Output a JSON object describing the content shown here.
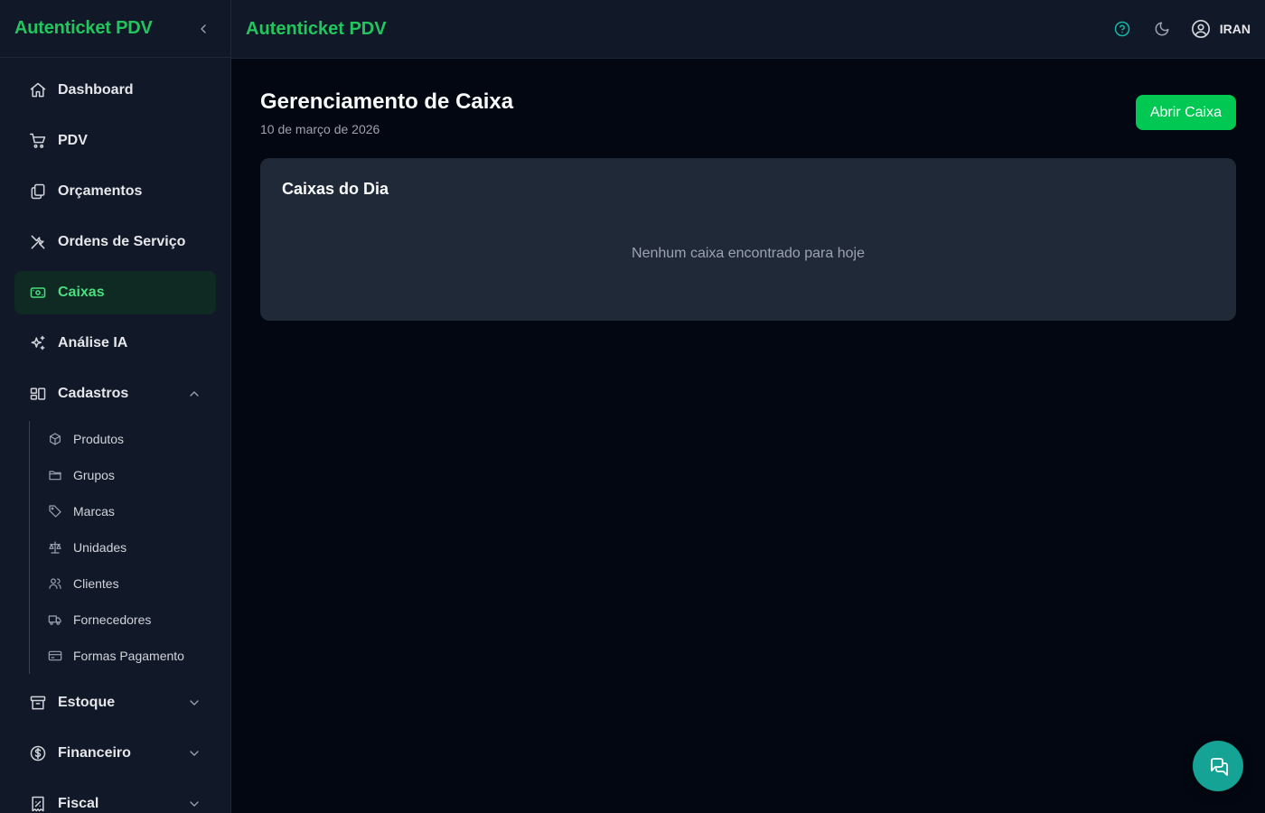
{
  "app": {
    "brand": "Autenticket PDV"
  },
  "sidebar": {
    "items": [
      {
        "label": "Dashboard",
        "icon": "home-icon"
      },
      {
        "label": "PDV",
        "icon": "cart-icon"
      },
      {
        "label": "Orçamentos",
        "icon": "documents-icon"
      },
      {
        "label": "Ordens de Serviço",
        "icon": "tools-icon"
      },
      {
        "label": "Caixas",
        "icon": "cash-icon",
        "active": true
      },
      {
        "label": "Análise IA",
        "icon": "sparkles-icon"
      },
      {
        "label": "Cadastros",
        "icon": "grid-icon",
        "expanded": true
      }
    ],
    "cadastros": [
      {
        "label": "Produtos",
        "icon": "box-icon"
      },
      {
        "label": "Grupos",
        "icon": "folder-icon"
      },
      {
        "label": "Marcas",
        "icon": "tag-icon"
      },
      {
        "label": "Unidades",
        "icon": "scale-icon"
      },
      {
        "label": "Clientes",
        "icon": "users-icon"
      },
      {
        "label": "Fornecedores",
        "icon": "truck-icon"
      },
      {
        "label": "Formas Pagamento",
        "icon": "card-icon"
      }
    ],
    "after": [
      {
        "label": "Estoque",
        "icon": "archive-icon"
      },
      {
        "label": "Financeiro",
        "icon": "dollar-icon"
      },
      {
        "label": "Fiscal",
        "icon": "receipt-icon"
      }
    ]
  },
  "topbar": {
    "title": "Autenticket PDV",
    "user": "IRAN"
  },
  "main": {
    "title": "Gerenciamento de Caixa",
    "date": "10 de março de 2026",
    "open_button": "Abrir Caixa",
    "card": {
      "title": "Caixas do Dia",
      "empty": "Nenhum caixa encontrado para hoje"
    }
  },
  "colors": {
    "accent": "#22c55e",
    "button": "#00c853",
    "fab": "#14a394",
    "active_bg": "#0f2a22"
  }
}
